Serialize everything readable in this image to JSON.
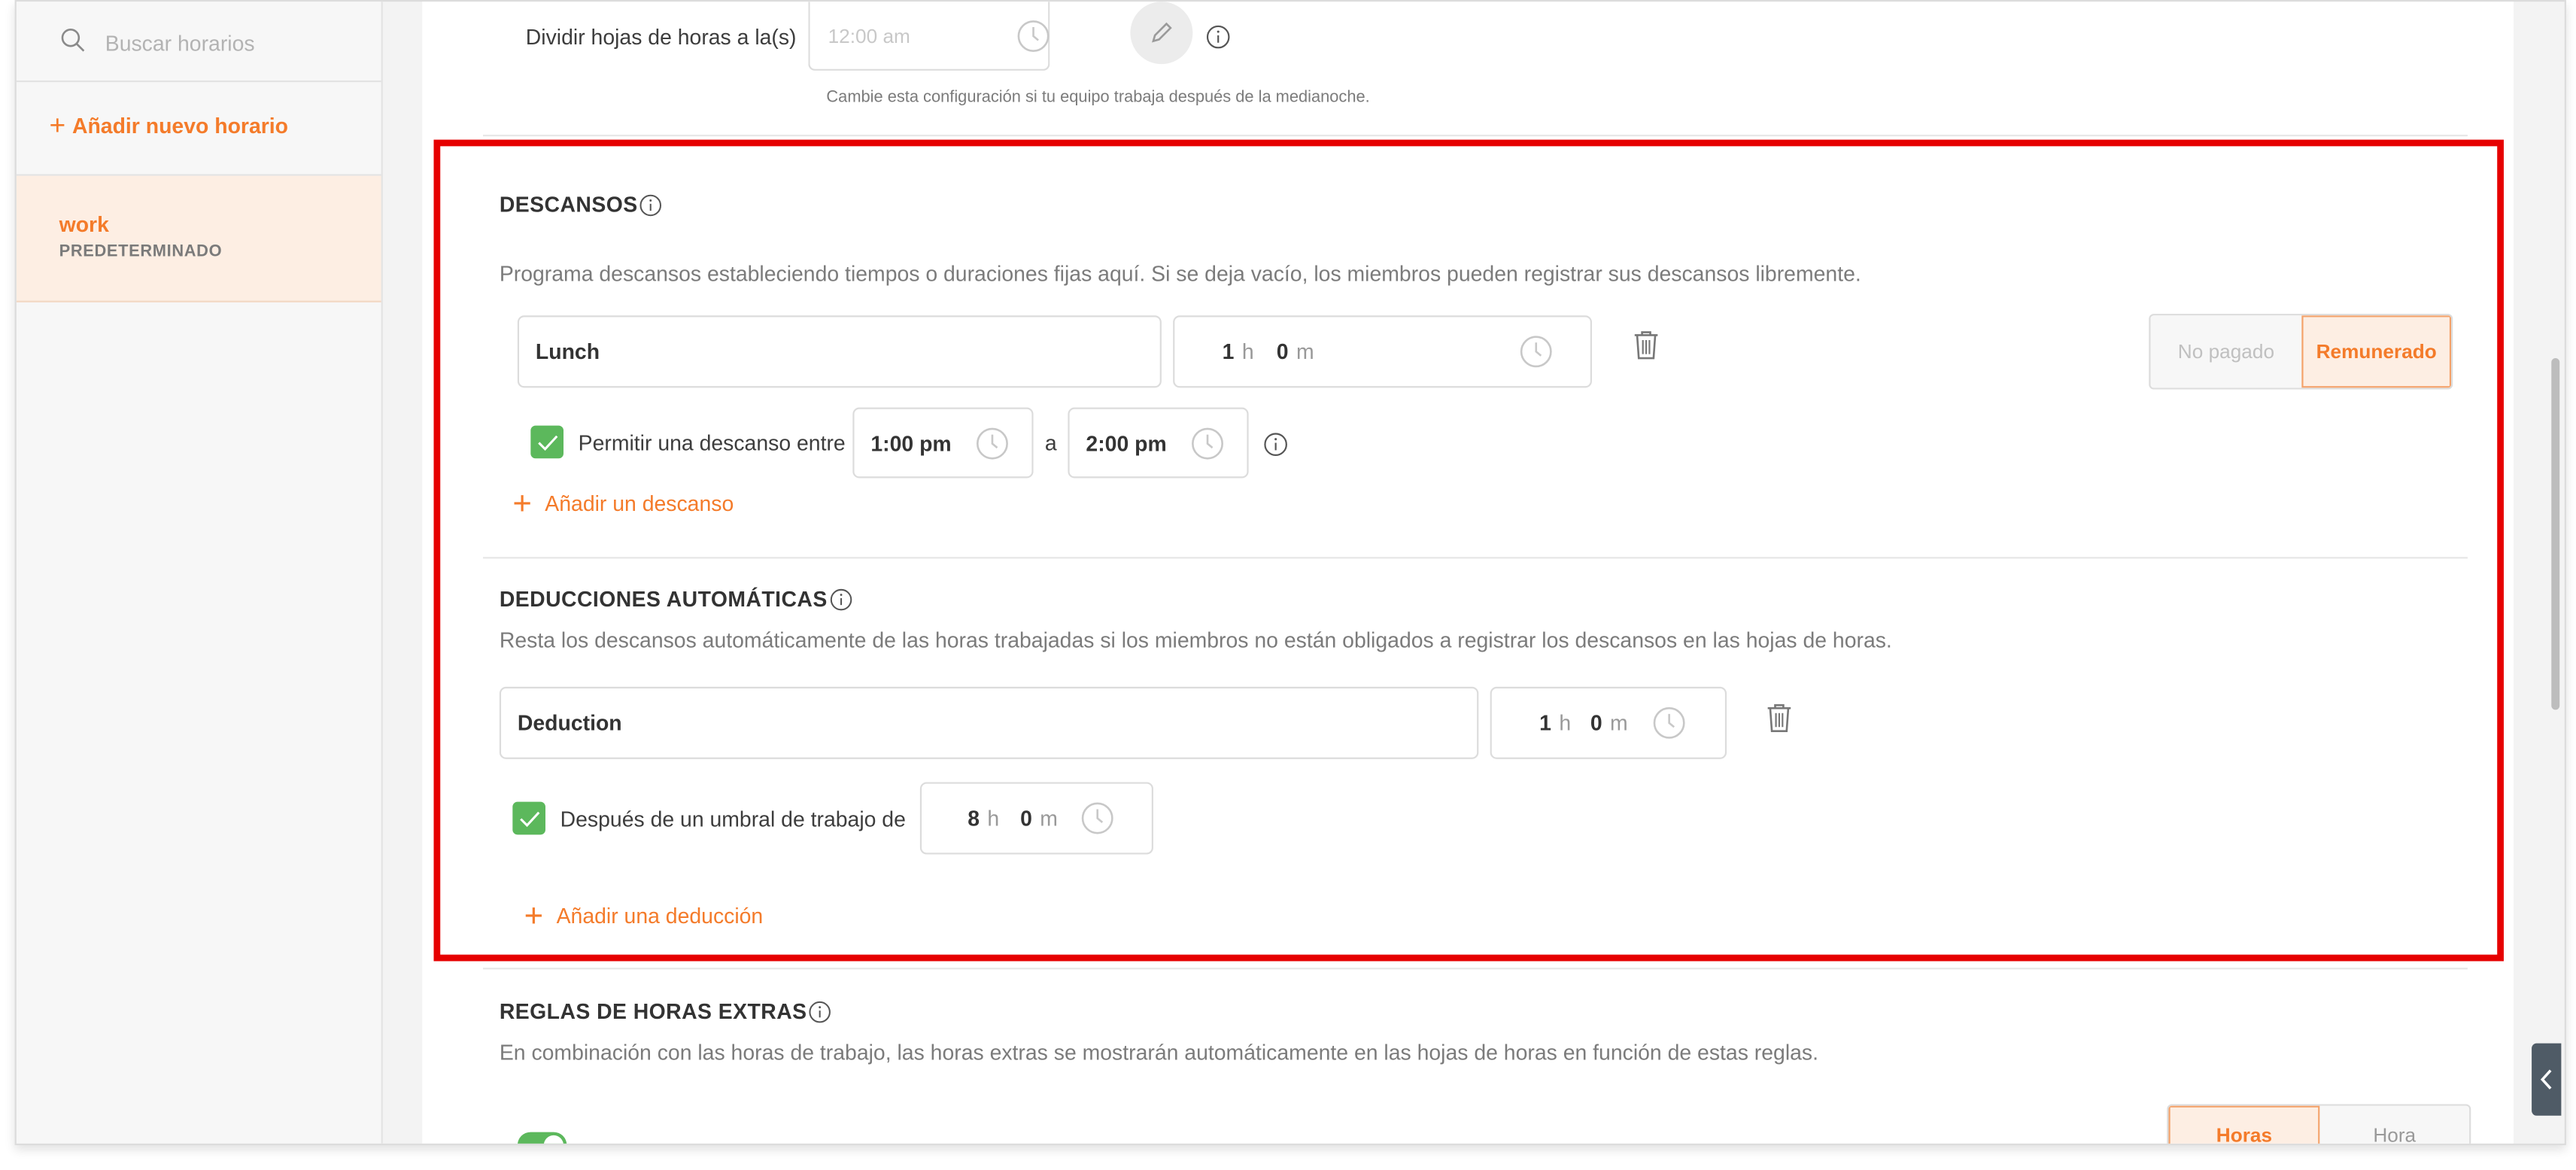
{
  "sidebar": {
    "search_placeholder": "Buscar horarios",
    "add_schedule_label": "Añadir nuevo horario",
    "schedules": [
      {
        "name": "work",
        "tag": "PREDETERMINADO"
      }
    ]
  },
  "split_timesheets": {
    "label": "Dividir hojas de horas a la(s)",
    "time_placeholder": "12:00 am",
    "hint": "Cambie esta configuración si tu equipo trabaja después de la medianoche."
  },
  "breaks": {
    "title": "DESCANSOS",
    "description": "Programa descansos estableciendo tiempos o duraciones fijas aquí. Si se deja vacío, los miembros pueden registrar sus descansos libremente.",
    "item": {
      "name": "Lunch",
      "hours": "1",
      "hours_unit": "h",
      "minutes": "0",
      "minutes_unit": "m",
      "unpaid_label": "No pagado",
      "paid_label": "Remunerado",
      "window_label": "Permitir una descanso entre",
      "window_start": "1:00 pm",
      "window_sep": "a",
      "window_end": "2:00 pm"
    },
    "add_label": "Añadir un descanso"
  },
  "deductions": {
    "title": "DEDUCCIONES AUTOMÁTICAS",
    "description": "Resta los descansos automáticamente de las horas trabajadas si los miembros no están obligados a registrar los descansos en las hojas de horas.",
    "item": {
      "name": "Deduction",
      "hours": "1",
      "hours_unit": "h",
      "minutes": "0",
      "minutes_unit": "m",
      "threshold_label": "Después de un umbral de trabajo de",
      "threshold_hours": "8",
      "threshold_minutes": "0"
    },
    "add_label": "Añadir una deducción"
  },
  "overtime": {
    "title": "REGLAS DE HORAS EXTRAS",
    "description": "En combinación con las horas de trabajo, las horas extras se mostrarán automáticamente en las hojas de horas en función de estas reglas.",
    "seg_hours": "Horas",
    "seg_hour": "Hora"
  },
  "colors": {
    "accent": "#f47b2a",
    "check": "#5cb85c",
    "highlight": "#e60000"
  }
}
